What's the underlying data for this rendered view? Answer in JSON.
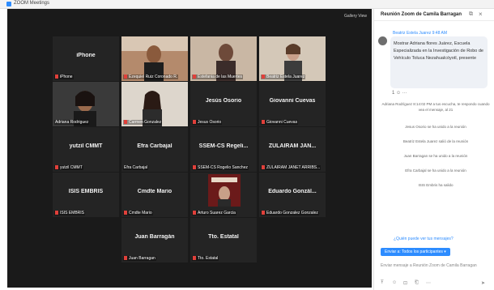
{
  "window": {
    "title": "ZOOM Meetings"
  },
  "meeting": {
    "view_label": "Gallery View",
    "tiles": [
      {
        "big_name": "iPhone",
        "caption": "iPhone"
      },
      {
        "big_name": "",
        "caption": "Ezequiel Ruiz Coronado R."
      },
      {
        "big_name": "",
        "caption": "Estefania de las Muertes"
      },
      {
        "big_name": "",
        "caption": "Beatriz Estela Juarez"
      },
      {
        "big_name": "",
        "caption": "Adriana Rodriguez"
      },
      {
        "big_name": "",
        "caption": "Carmen Gonzalez"
      },
      {
        "big_name": "Jesús Osorio",
        "caption": "Jesus Osorio"
      },
      {
        "big_name": "Giovanni Cuevas",
        "caption": "Giovanni Cuevas"
      },
      {
        "big_name": "yutzil CMMT",
        "caption": "yutzil CMMT"
      },
      {
        "big_name": "Efra Carbajal",
        "caption": "Efra Carbajal"
      },
      {
        "big_name": "SSEM-CS Regeli...",
        "caption": "SSEM-CS Rogelio Sanchez"
      },
      {
        "big_name": "ZULAIRAM JAN...",
        "caption": "ZULAIRAM JANET ARRIBS..."
      },
      {
        "big_name": "ISIS EMBRIS",
        "caption": "ISIS EMBRIS"
      },
      {
        "big_name": "Cmdte Mario",
        "caption": "Cmdte Mario"
      },
      {
        "big_name": "",
        "caption": "Arturo Suarez Garcia"
      },
      {
        "big_name": "Eduardo Gonzál...",
        "caption": "Eduardo Gonzalez Gonzalez"
      },
      {
        "big_name": "Juan Barragán",
        "caption": "Juan Barragan"
      },
      {
        "big_name": "Tto. Estatal",
        "caption": "Tto. Estatal"
      }
    ]
  },
  "chat": {
    "title": "Reunión Zoom de Camila Barragan",
    "sender": "Beatriz Estela Juarez  9:48 AM",
    "message": "Mostrar Adriana flores Juárez, Escuela Especializada en la Investigación de Robo de Vehículo Toluca Nezahualcóyotl, presente",
    "reactions": "1 ☺  ···",
    "system_messages": [
      "Adriana Rodríguez 8:14:02 PM a tus escucha, te respondo cuando vea el mensaje, al 21",
      "Jesus Osorio se ha unido a la reunión",
      "Beatriz Estela Juarez salió de la reunión",
      "Juan Barragan se ha unido a la reunión",
      "Efra Carbajal se ha unido a la reunión",
      "ISIS Embris ha salido"
    ],
    "new_messages_link": "¿Quién puede ver tus mensajes?",
    "to_label": "Enviar a: Todos los participantes ▾",
    "input_placeholder": "Enviar mensaje a Reunión Zoom de Camila Barragan",
    "toolbar_icons": [
      "format-icon",
      "emoji-icon",
      "screenshot-icon",
      "file-icon",
      "more-icon",
      "send-icon"
    ]
  }
}
